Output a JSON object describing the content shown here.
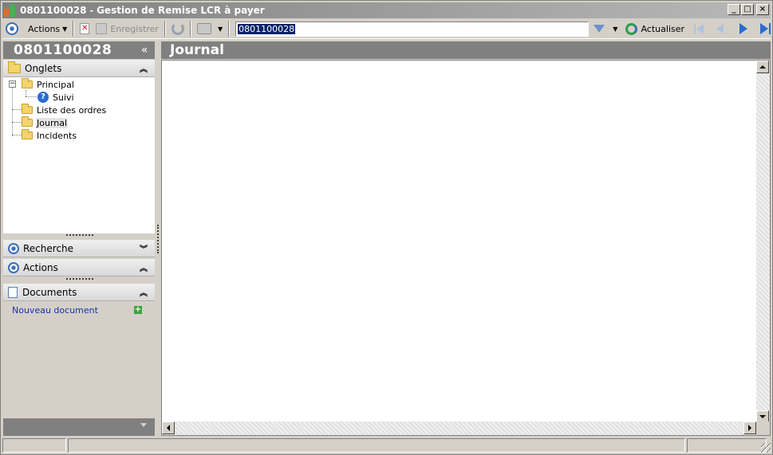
{
  "window": {
    "id": "0801100028",
    "separator": "-",
    "title": "Gestion de Remise LCR à payer",
    "controls": [
      "minimize",
      "maximize",
      "close"
    ]
  },
  "toolbar": {
    "actions_label": "Actions",
    "save_label": "Enregistrer",
    "search_value": "0801100028",
    "refresh_label": "Actualiser"
  },
  "left": {
    "header": "0801100028",
    "collapse_glyph": "«",
    "sections": {
      "onglets": "Onglets",
      "recherche": "Recherche",
      "actions": "Actions",
      "documents": "Documents"
    },
    "tree": {
      "principal": "Principal",
      "suivi": "Suivi",
      "liste": "Liste des ordres",
      "journal": "Journal",
      "incidents": "Incidents"
    },
    "new_document": "Nouveau document"
  },
  "main": {
    "header": "Journal"
  },
  "icons": {
    "app": "app-icon",
    "actions": "actions-circle-icon",
    "delete": "delete-icon",
    "save": "save-icon",
    "sync": "sync-icon",
    "print": "print-icon",
    "filter": "filter-icon",
    "refresh": "refresh-icon",
    "folder": "folder-icon",
    "help": "help-icon",
    "document": "document-icon"
  },
  "colors": {
    "accent_blue": "#3b6fb6",
    "header_gray": "#808080",
    "link_blue": "#1a33a8",
    "selection": "#0a246a"
  }
}
